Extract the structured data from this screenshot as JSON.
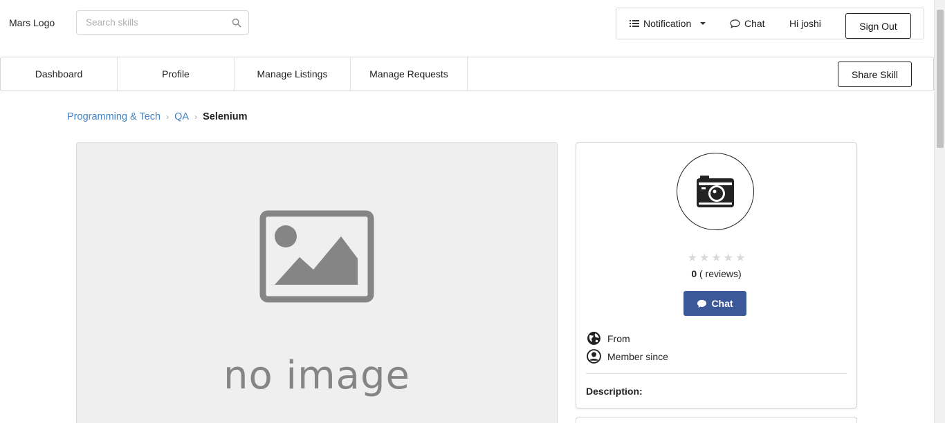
{
  "header": {
    "logo": "Mars Logo",
    "search": {
      "placeholder": "Search skills",
      "value": ""
    },
    "notification_label": "Notification",
    "chat_label": "Chat",
    "greeting": "Hi joshi",
    "signout_label": "Sign Out"
  },
  "nav": {
    "items": [
      {
        "label": "Dashboard"
      },
      {
        "label": "Profile"
      },
      {
        "label": "Manage Listings"
      },
      {
        "label": "Manage Requests"
      }
    ],
    "share_label": "Share Skill"
  },
  "breadcrumb": {
    "items": [
      "Programming & Tech",
      "QA"
    ],
    "current": "Selenium"
  },
  "main_image": {
    "placeholder_text": "no image"
  },
  "seller": {
    "rating_stars": 0,
    "max_stars": 5,
    "review_count": "0",
    "reviews_label": "( reviews)",
    "chat_label": "Chat",
    "from_label": "From",
    "member_since_label": "Member since",
    "description_label": "Description:"
  },
  "colors": {
    "chat_button": "#3b5998",
    "link": "#4183c4",
    "star_empty": "#d9d9d9",
    "placeholder_bg": "#efefef",
    "placeholder_graphic": "#858585"
  },
  "icons": {
    "search": "search-icon",
    "notification": "list-icon",
    "caret": "caret-down-icon",
    "chat": "chat-bubble-icon",
    "from": "globe-icon",
    "member": "user-circle-icon",
    "avatar": "camera-icon"
  }
}
